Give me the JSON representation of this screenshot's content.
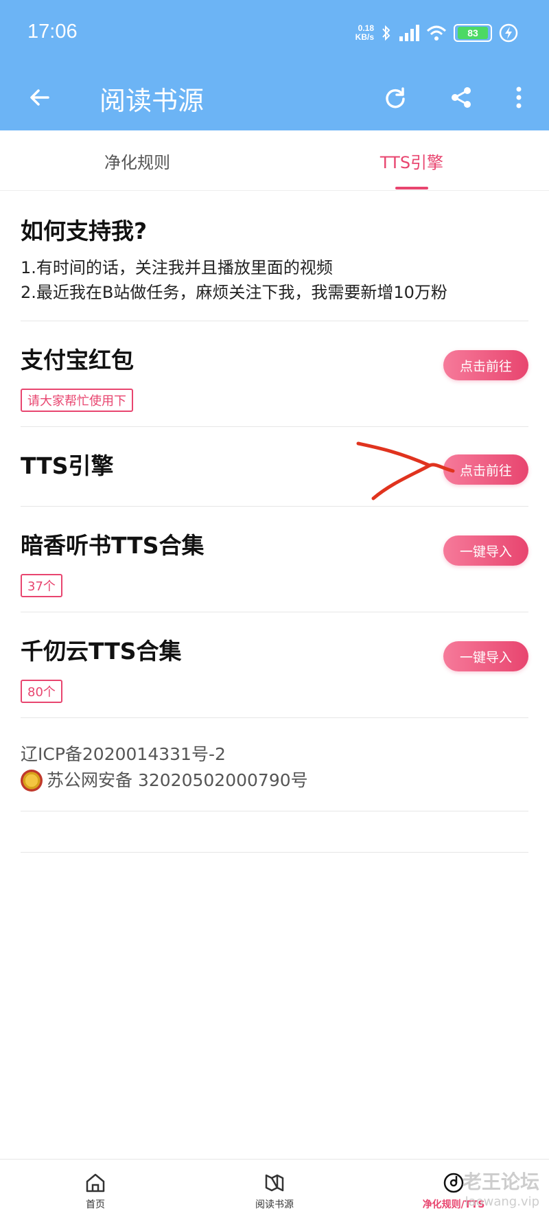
{
  "status": {
    "time": "17:06",
    "net_speed_value": "0.18",
    "net_speed_unit": "KB/s",
    "battery": "83"
  },
  "toolbar": {
    "title": "阅读书源"
  },
  "tabs": [
    {
      "label": "净化规则"
    },
    {
      "label": "TTS引擎"
    }
  ],
  "support": {
    "title": "如何支持我?",
    "lines": [
      "1.有时间的话，关注我并且播放里面的视频",
      "2.最近我在B站做任务，麻烦关注下我，我需要新增10万粉"
    ]
  },
  "items": [
    {
      "title": "支付宝红包",
      "tag": "请大家帮忙使用下",
      "button": "点击前往"
    },
    {
      "title": "TTS引擎",
      "button": "点击前往"
    },
    {
      "title": "暗香听书TTS合集",
      "tag": "37个",
      "button": "一键导入"
    },
    {
      "title": "千仞云TTS合集",
      "tag": "80个",
      "button": "一键导入"
    }
  ],
  "footer": {
    "icp": "辽ICP备2020014331号-2",
    "police": "苏公网安备 32020502000790号"
  },
  "bottom_nav": [
    {
      "label": "首页",
      "icon": "home-icon"
    },
    {
      "label": "阅读书源",
      "icon": "book-source-icon"
    },
    {
      "label": "净化规则/TTS",
      "icon": "disc-icon"
    }
  ],
  "watermark": {
    "line1": "老王论坛",
    "line2": "laowang.vip"
  },
  "colors": {
    "appbar": "#6cb4f5",
    "accent": "#e8456f",
    "annotation": "#e0331e"
  }
}
